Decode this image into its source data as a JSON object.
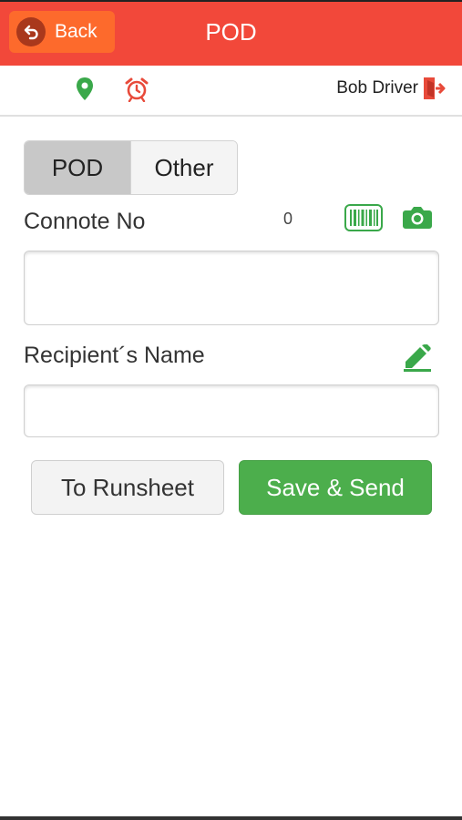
{
  "header": {
    "back_label": "Back",
    "title": "POD",
    "background": "#f2483a",
    "back_color": "#fd6a2c"
  },
  "subbar": {
    "icons": [
      "map-pin-icon",
      "alarm-clock-icon"
    ],
    "driver_name": "Bob Driver",
    "logout_icon": "logout-icon"
  },
  "tabs": [
    {
      "label": "POD",
      "active": true
    },
    {
      "label": "Other",
      "active": false
    }
  ],
  "connote": {
    "label": "Connote No",
    "count": "0",
    "value": "",
    "icons": [
      "barcode-scan-icon",
      "camera-icon"
    ]
  },
  "recipient": {
    "label": "Recipient´s Name",
    "value": "",
    "icon": "signature-pen-icon"
  },
  "actions": {
    "runsheet_label": "To Runsheet",
    "save_label": "Save & Send"
  },
  "colors": {
    "accent_green": "#4cae4c",
    "header_red": "#f2483a",
    "icon_red": "#e84a3a"
  }
}
